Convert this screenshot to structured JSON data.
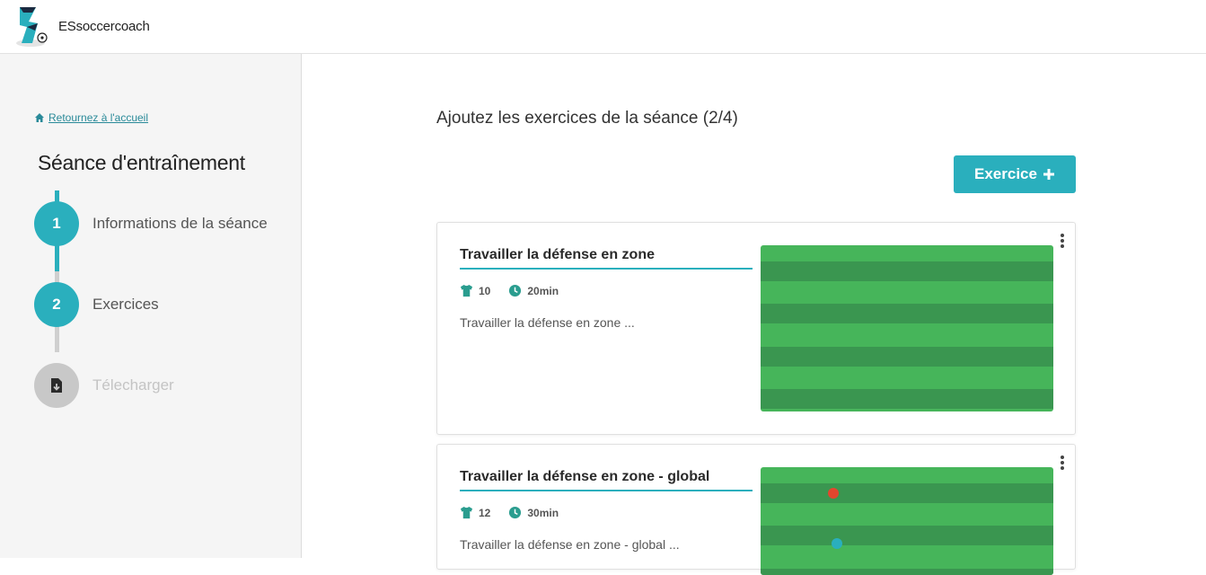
{
  "header": {
    "brand": "ESsoccercoach",
    "logo_icon": "soccer-coach-logo"
  },
  "sidebar": {
    "back_link": "Retournez à l'accueil",
    "title": "Séance d'entraînement",
    "steps": [
      {
        "number": "1",
        "label": "Informations de la séance",
        "state": "done"
      },
      {
        "number": "2",
        "label": "Exercices",
        "state": "active"
      },
      {
        "number": "",
        "label": "Télecharger",
        "state": "disabled",
        "icon": "download-file-icon"
      }
    ]
  },
  "main": {
    "title": "Ajoutez les exercices de la séance (2/4)",
    "add_button": "Exercice",
    "exercises": [
      {
        "title": "Travailler la défense en zone",
        "players": "10",
        "duration": "20min",
        "description": "Travailler la défense en zone ..."
      },
      {
        "title": "Travailler la défense en zone - global",
        "players": "12",
        "duration": "30min",
        "description": "Travailler la défense en zone - global ..."
      }
    ]
  },
  "colors": {
    "accent": "#2aafbd",
    "field_light": "#46b55a",
    "field_dark": "#3a9650",
    "player_red": "#e2462e",
    "player_blue": "#2aafbd"
  }
}
